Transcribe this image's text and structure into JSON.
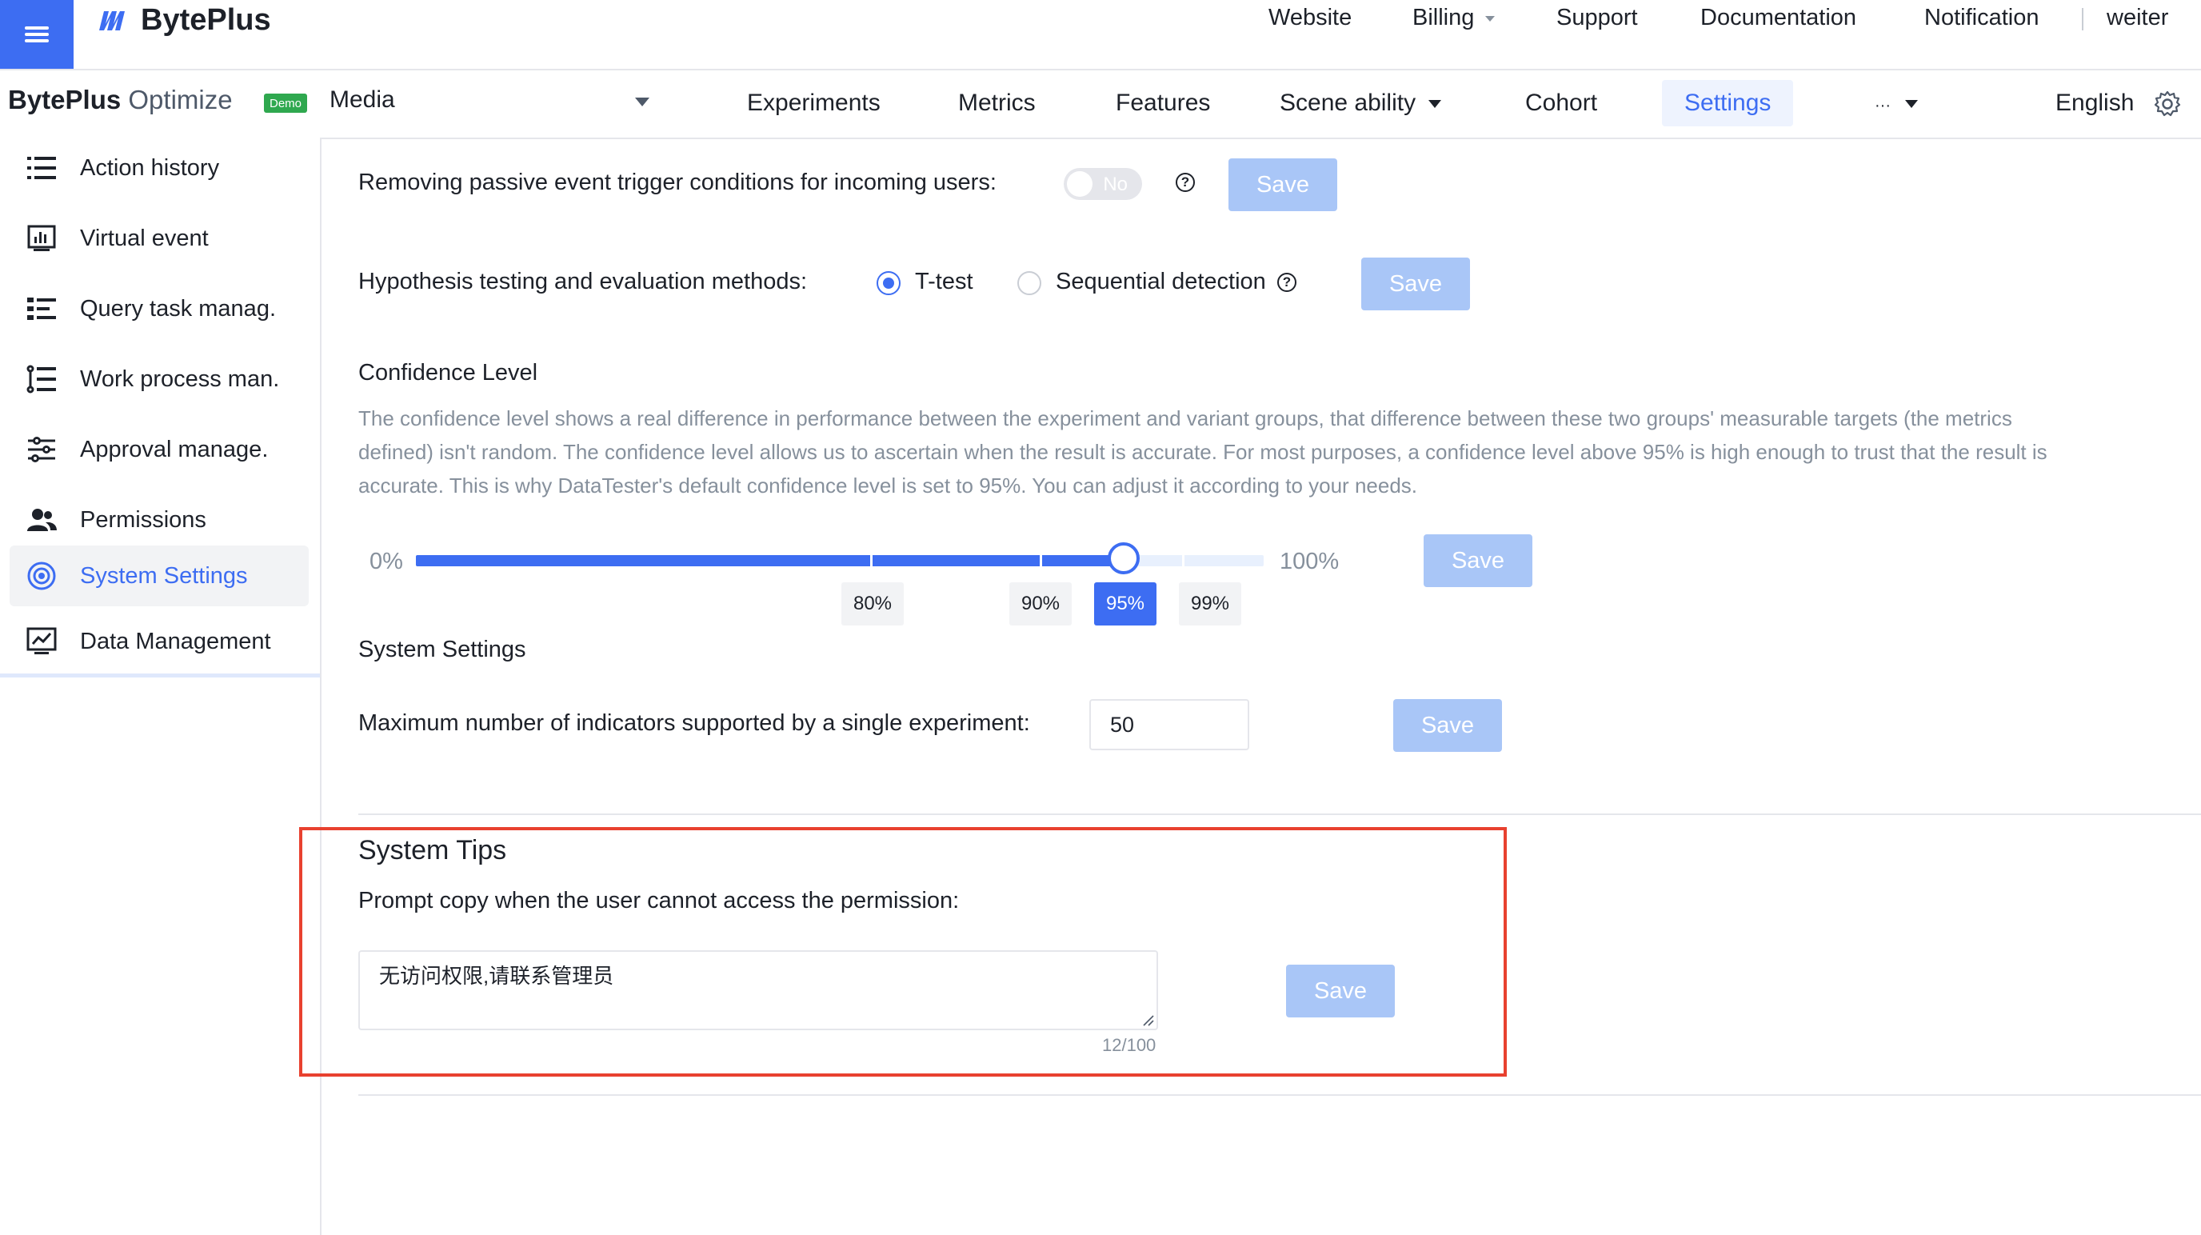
{
  "topbar": {
    "logo_text": "BytePlus",
    "nav": [
      {
        "label": "Website"
      },
      {
        "label": "Billing"
      },
      {
        "label": "Support"
      },
      {
        "label": "Documentation"
      },
      {
        "label": "Notification"
      },
      {
        "label": "weiter"
      }
    ]
  },
  "productbar": {
    "brand_bold": "BytePlus",
    "brand_thin": "Optimize",
    "badge": "Demo",
    "app_name": "Media",
    "nav": [
      {
        "label": "Experiments"
      },
      {
        "label": "Metrics"
      },
      {
        "label": "Features"
      },
      {
        "label": "Scene ability"
      },
      {
        "label": "Cohort"
      },
      {
        "label": "Settings"
      },
      {
        "label": "···"
      }
    ],
    "active_nav": "Settings",
    "language": "English"
  },
  "sidebar": {
    "items": [
      {
        "label": "Action history",
        "icon": "list-icon"
      },
      {
        "label": "Virtual event",
        "icon": "chart-board-icon"
      },
      {
        "label": "Query task manag.",
        "icon": "task-list-icon"
      },
      {
        "label": "Work process man.",
        "icon": "process-list-icon"
      },
      {
        "label": "Approval manage.",
        "icon": "sliders-icon"
      },
      {
        "label": "Permissions",
        "icon": "users-icon"
      },
      {
        "label": "System Settings",
        "icon": "target-icon"
      },
      {
        "label": "Data Management",
        "icon": "monitor-chart-icon"
      }
    ],
    "active_item": "System Settings"
  },
  "passive_event": {
    "label": "Removing passive event trigger conditions for incoming users:",
    "toggle_text": "No",
    "toggle_on": false,
    "save_label": "Save"
  },
  "hypothesis": {
    "label": "Hypothesis testing and evaluation methods:",
    "options": [
      {
        "label": "T-test",
        "selected": true
      },
      {
        "label": "Sequential detection",
        "selected": false
      }
    ],
    "save_label": "Save"
  },
  "confidence": {
    "title": "Confidence Level",
    "description_lines": [
      "The confidence level shows a real difference in performance between the experiment and variant groups, that difference between these two groups' measurable targets (the metrics",
      "defined) isn't random. The confidence level allows us to ascertain when the result is accurate. For most purposes, a confidence level above 95% is high enough to trust that the result is",
      "accurate. This is why DataTester's default confidence level is set to 95%. You can adjust it according to your needs."
    ],
    "min_label": "0%",
    "max_label": "100%",
    "value_percent": 95,
    "marks": [
      "80%",
      "90%",
      "95%",
      "99%"
    ],
    "active_mark": "95%",
    "save_label": "Save"
  },
  "system_settings": {
    "title": "System Settings",
    "max_indicators_label": "Maximum number of indicators supported by a single experiment:",
    "max_indicators_value": "50",
    "save_label": "Save"
  },
  "system_tips": {
    "title": "System Tips",
    "prompt_label": "Prompt copy when the user cannot access the permission:",
    "prompt_value": "无访问权限,请联系管理员",
    "char_count": "12/100",
    "save_label": "Save"
  },
  "colors": {
    "primary": "#3d6df2",
    "save_disabled": "#a9c6f7",
    "highlight_box": "#e8412f",
    "demo_badge": "#2fa84f"
  }
}
